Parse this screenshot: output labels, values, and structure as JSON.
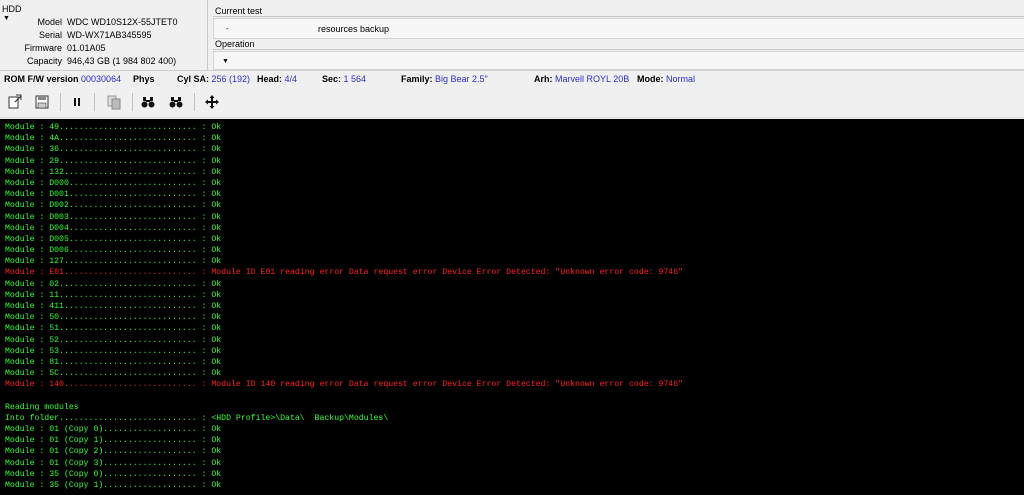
{
  "hdd_panel": {
    "title": "HDD",
    "fields": [
      {
        "label": "Model",
        "value": "WDC WD10S12X-55JTET0"
      },
      {
        "label": "Serial",
        "value": "WD-WX71AB345595"
      },
      {
        "label": "Firmware",
        "value": "01.01A05"
      },
      {
        "label": "Capacity",
        "value": "946,43 GB (1 984 802 400)"
      }
    ]
  },
  "current_test": {
    "title": "Current test",
    "dash": "-",
    "value": "resources backup"
  },
  "operation": {
    "title": "Operation"
  },
  "infobar": {
    "rom_label": "ROM F/W version",
    "rom_value": "00030064",
    "phys_label": "Phys",
    "cyl_label": "Cyl SA:",
    "cyl_value": "256 (192)",
    "head_label": "Head:",
    "head_value": "4/4",
    "sec_label": "Sec:",
    "sec_value": "1 564",
    "family_label": "Family:",
    "family_value": "Big Bear 2.5\"",
    "arh_label": "Arh:",
    "arh_value": "Marvell ROYL 20B",
    "mode_label": "Mode:",
    "mode_value": "Normal"
  },
  "toolbar": {
    "buttons": [
      "open-file-icon",
      "save-icon",
      "pause-icon",
      "copy-icon",
      "binoculars-icon",
      "binoculars-next-icon",
      "move-arrows-icon"
    ]
  },
  "colors": {
    "console_ok": "#33ff33",
    "console_error": "#ff2020",
    "info_link": "#2c2cd8"
  },
  "console": {
    "lines": [
      {
        "text": "Module : 49............................ : Ok",
        "status": "ok"
      },
      {
        "text": "Module : 4A............................ : Ok",
        "status": "ok"
      },
      {
        "text": "Module : 36............................ : Ok",
        "status": "ok"
      },
      {
        "text": "Module : 29............................ : Ok",
        "status": "ok"
      },
      {
        "text": "Module : 132........................... : Ok",
        "status": "ok"
      },
      {
        "text": "Module : D000.......................... : Ok",
        "status": "ok"
      },
      {
        "text": "Module : D001.......................... : Ok",
        "status": "ok"
      },
      {
        "text": "Module : D002.......................... : Ok",
        "status": "ok"
      },
      {
        "text": "Module : D003.......................... : Ok",
        "status": "ok"
      },
      {
        "text": "Module : D004.......................... : Ok",
        "status": "ok"
      },
      {
        "text": "Module : D005.......................... : Ok",
        "status": "ok"
      },
      {
        "text": "Module : D006.......................... : Ok",
        "status": "ok"
      },
      {
        "text": "Module : 127........................... : Ok",
        "status": "ok"
      },
      {
        "text": "Module : E01........................... : Module ID E01 reading error Data request error Device Error Detected: \"Unknown error code: 9746\"",
        "status": "error"
      },
      {
        "text": "Module : 02............................ : Ok",
        "status": "ok"
      },
      {
        "text": "Module : 11............................ : Ok",
        "status": "ok"
      },
      {
        "text": "Module : 411........................... : Ok",
        "status": "ok"
      },
      {
        "text": "Module : 50............................ : Ok",
        "status": "ok"
      },
      {
        "text": "Module : 51............................ : Ok",
        "status": "ok"
      },
      {
        "text": "Module : 52............................ : Ok",
        "status": "ok"
      },
      {
        "text": "Module : 53............................ : Ok",
        "status": "ok"
      },
      {
        "text": "Module : 81............................ : Ok",
        "status": "ok"
      },
      {
        "text": "Module : 5C............................ : Ok",
        "status": "ok"
      },
      {
        "text": "Module : 140........................... : Module ID 140 reading error Data request error Device Error Detected: \"Unknown error code: 9746\"",
        "status": "error"
      },
      {
        "text": "",
        "status": "ok"
      },
      {
        "text": "Reading modules",
        "status": "ok"
      },
      {
        "text": "Into folder............................ : <HDD Profile>\\Data\\  Backup\\Modules\\",
        "status": "ok"
      },
      {
        "text": "Module : 01 (Copy 0)................... : Ok",
        "status": "ok"
      },
      {
        "text": "Module : 01 (Copy 1)................... : Ok",
        "status": "ok"
      },
      {
        "text": "Module : 01 (Copy 2)................... : Ok",
        "status": "ok"
      },
      {
        "text": "Module : 01 (Copy 3)................... : Ok",
        "status": "ok"
      },
      {
        "text": "Module : 35 (Copy 0)................... : Ok",
        "status": "ok"
      },
      {
        "text": "Module : 35 (Copy 1)................... : Ok",
        "status": "ok"
      }
    ]
  }
}
